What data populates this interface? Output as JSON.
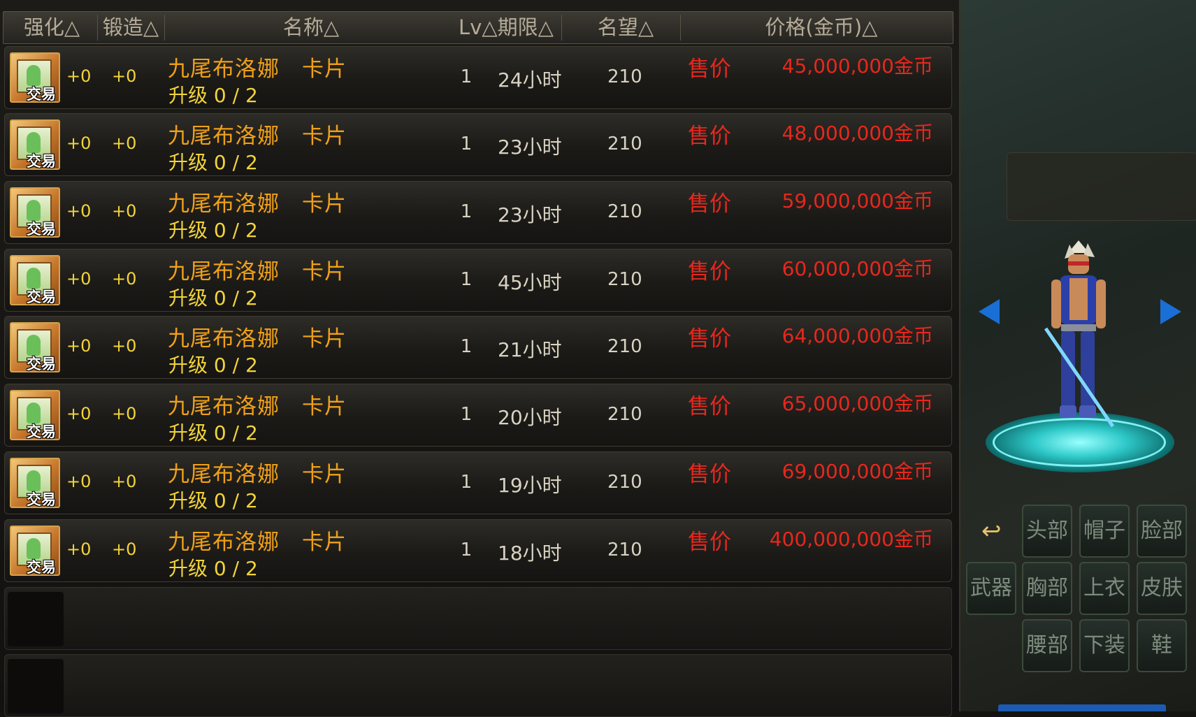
{
  "header": {
    "enhance": "强化△",
    "forge": "锻造△",
    "name": "名称△",
    "lv_duration": "Lv△期限△",
    "reputation": "名望△",
    "price": "价格(金币)△"
  },
  "listings": [
    {
      "enhance": "+0",
      "forge": "+0",
      "name": "九尾布洛娜　卡片",
      "upgrade": "升级 0 / 2",
      "level": "1",
      "duration": "24小时",
      "reputation": "210",
      "sale_label": "售价",
      "price": "45,000,000金币",
      "badge": "交易"
    },
    {
      "enhance": "+0",
      "forge": "+0",
      "name": "九尾布洛娜　卡片",
      "upgrade": "升级 0 / 2",
      "level": "1",
      "duration": "23小时",
      "reputation": "210",
      "sale_label": "售价",
      "price": "48,000,000金币",
      "badge": "交易"
    },
    {
      "enhance": "+0",
      "forge": "+0",
      "name": "九尾布洛娜　卡片",
      "upgrade": "升级 0 / 2",
      "level": "1",
      "duration": "23小时",
      "reputation": "210",
      "sale_label": "售价",
      "price": "59,000,000金币",
      "badge": "交易"
    },
    {
      "enhance": "+0",
      "forge": "+0",
      "name": "九尾布洛娜　卡片",
      "upgrade": "升级 0 / 2",
      "level": "1",
      "duration": "45小时",
      "reputation": "210",
      "sale_label": "售价",
      "price": "60,000,000金币",
      "badge": "交易"
    },
    {
      "enhance": "+0",
      "forge": "+0",
      "name": "九尾布洛娜　卡片",
      "upgrade": "升级 0 / 2",
      "level": "1",
      "duration": "21小时",
      "reputation": "210",
      "sale_label": "售价",
      "price": "64,000,000金币",
      "badge": "交易"
    },
    {
      "enhance": "+0",
      "forge": "+0",
      "name": "九尾布洛娜　卡片",
      "upgrade": "升级 0 / 2",
      "level": "1",
      "duration": "20小时",
      "reputation": "210",
      "sale_label": "售价",
      "price": "65,000,000金币",
      "badge": "交易"
    },
    {
      "enhance": "+0",
      "forge": "+0",
      "name": "九尾布洛娜　卡片",
      "upgrade": "升级 0 / 2",
      "level": "1",
      "duration": "19小时",
      "reputation": "210",
      "sale_label": "售价",
      "price": "69,000,000金币",
      "badge": "交易"
    },
    {
      "enhance": "+0",
      "forge": "+0",
      "name": "九尾布洛娜　卡片",
      "upgrade": "升级 0 / 2",
      "level": "1",
      "duration": "18小时",
      "reputation": "210",
      "sale_label": "售价",
      "price": "400,000,000金币",
      "badge": "交易"
    }
  ],
  "equipment_slots": {
    "head": "头部",
    "hat": "帽子",
    "face": "脸部",
    "weapon": "武器",
    "chest": "胸部",
    "top": "上衣",
    "skin": "皮肤",
    "waist": "腰部",
    "bottom": "下装",
    "shoes": "鞋"
  },
  "icons": {
    "card": "card-icon",
    "prev": "arrow-left-icon",
    "next": "arrow-right-icon",
    "back": "return-arrow-icon"
  },
  "colors": {
    "name": "#f0a018",
    "price": "#e8271c",
    "upgrade": "#f2d43a",
    "header_text": "#b5ab98"
  }
}
